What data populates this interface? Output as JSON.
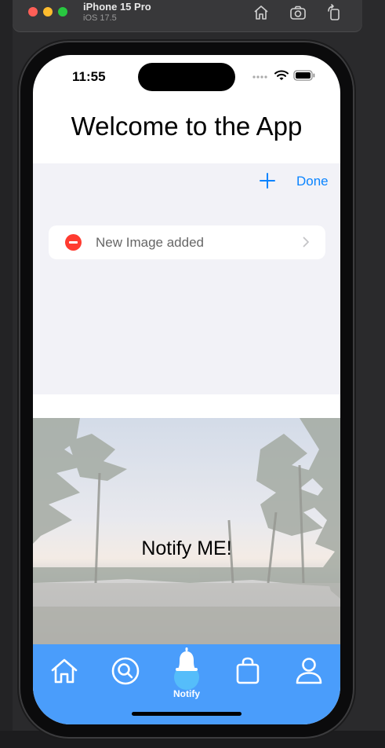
{
  "simulator": {
    "device_name": "iPhone 15 Pro",
    "os_version": "iOS 17.5"
  },
  "status_bar": {
    "time": "11:55"
  },
  "app": {
    "title": "Welcome to the App",
    "toolbar": {
      "done_label": "Done"
    },
    "list_items": [
      {
        "label": "New Image added"
      }
    ],
    "banner_text": "Notify ME!",
    "tabs": [
      {
        "icon": "house-icon"
      },
      {
        "icon": "search-icon"
      },
      {
        "icon": "bell-icon",
        "label": "Notify",
        "selected": true
      },
      {
        "icon": "bag-icon"
      },
      {
        "icon": "person-icon"
      }
    ]
  },
  "colors": {
    "accent": "#0a84ff",
    "tab_bar": "#4a9dfb",
    "delete": "#ff3b30",
    "list_background": "#f2f2f7"
  }
}
